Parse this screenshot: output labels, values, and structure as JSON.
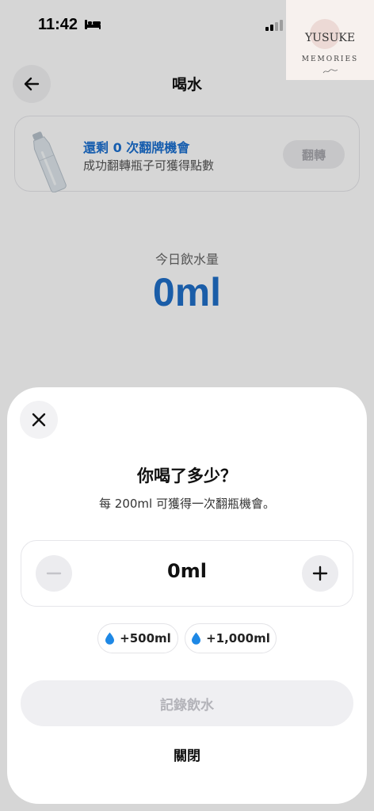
{
  "status_bar": {
    "time": "11:42"
  },
  "nav": {
    "title": "喝水"
  },
  "flip_card": {
    "title": "還剩 0 次翻牌機會",
    "subtitle": "成功翻轉瓶子可獲得點數",
    "button_label": "翻轉"
  },
  "today": {
    "label": "今日飲水量",
    "amount": "0ml"
  },
  "watermark": {
    "name": "YUSUKE",
    "subtitle": "MEMORIES"
  },
  "sheet": {
    "title": "你喝了多少？",
    "subtitle": "每 200ml 可獲得一次翻瓶機會。",
    "stepper_value": "0ml",
    "quick_add": [
      "+500ml",
      "+1,000ml"
    ],
    "record_button": "記錄飲水",
    "close_button": "關閉"
  },
  "colors": {
    "accent_blue": "#1f6fc9",
    "flip_title_blue": "#1b6fd0",
    "drop_blue": "#1e88e5",
    "disabled_text": "#b3b3b9"
  },
  "icons": {
    "back": "arrow-left-icon",
    "close": "close-icon",
    "minus": "minus-icon",
    "plus": "plus-icon",
    "drop": "water-drop-icon",
    "bottle": "bottle-image",
    "sleep_mode": "bed-icon",
    "signal": "signal-icon"
  }
}
